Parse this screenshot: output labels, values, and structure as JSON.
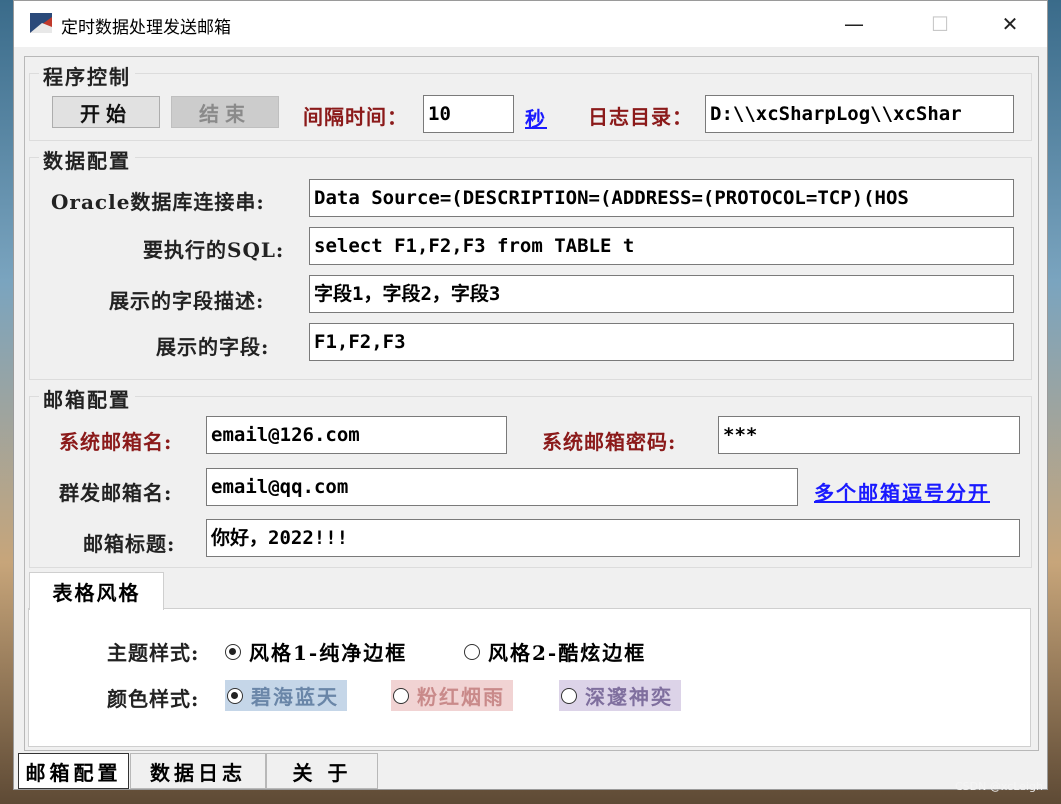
{
  "window": {
    "title": "定时数据处理发送邮箱",
    "minimize": "—",
    "maximize": "☐",
    "close": "✕"
  },
  "program_control": {
    "title": "程序控制",
    "start_label": "开始",
    "stop_label": "结束",
    "interval_label": "间隔时间：",
    "interval_value": "10",
    "seconds_label": "秒",
    "log_dir_label": "日志目录：",
    "log_dir_value": "D:\\\\xcSharpLog\\\\xcShar"
  },
  "data_config": {
    "title": "数据配置",
    "oracle_label": "Oracle数据库连接串:",
    "oracle_value": "Data Source=(DESCRIPTION=(ADDRESS=(PROTOCOL=TCP)(HOS",
    "sql_label": "要执行的SQL:",
    "sql_value": "select F1,F2,F3 from TABLE t",
    "field_desc_label": "展示的字段描述:",
    "field_desc_value": "字段1，字段2，字段3",
    "fields_label": "展示的字段:",
    "fields_value": "F1,F2,F3"
  },
  "mail_config": {
    "title": "邮箱配置",
    "sys_mail_label": "系统邮箱名:",
    "sys_mail_value": "email@126.com",
    "sys_pwd_label": "系统邮箱密码:",
    "sys_pwd_value": "***",
    "group_mail_label": "群发邮箱名:",
    "group_mail_value": "email@qq.com",
    "comma_hint": "多个邮箱逗号分开",
    "subject_label": "邮箱标题:",
    "subject_value": "你好，2022!!!"
  },
  "table_style": {
    "tab_label": "表格风格",
    "theme_label": "主题样式:",
    "theme_options": [
      "风格1-纯净边框",
      "风格2-酷炫边框"
    ],
    "theme_selected": 0,
    "color_label": "颜色样式:",
    "color_options": [
      "碧海蓝天",
      "粉红烟雨",
      "深邃神奕"
    ],
    "color_selected": 0,
    "color_swatches": [
      "#c5d6e8",
      "#f1d3d3",
      "#dcd3e8"
    ],
    "color_text": [
      "#6a86a8",
      "#c98a8a",
      "#7f6f9e"
    ]
  },
  "bottom_tabs": [
    "邮箱配置",
    "数据日志",
    "关  于"
  ],
  "watermark": "CSDN @xcLeigh"
}
